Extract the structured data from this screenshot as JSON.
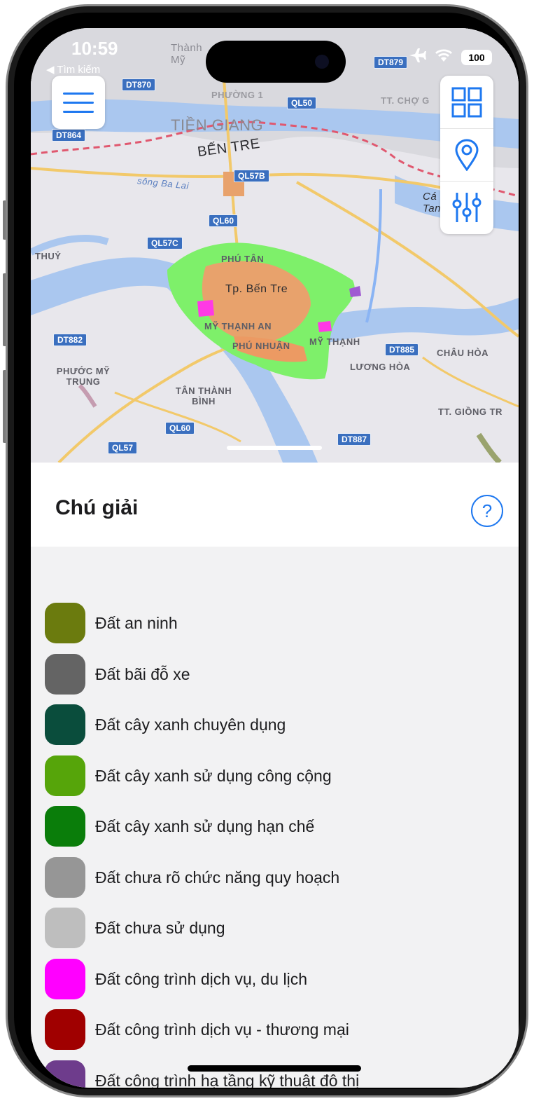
{
  "status_bar": {
    "time": "10:59",
    "back_label": "◀ Tìm kiếm",
    "battery": "100"
  },
  "map": {
    "city_label": "Tp. Bến Tre",
    "province_labels": [
      "TIỀN GIANG",
      "BẾN TRE"
    ],
    "place_labels": [
      "PHÚ TÂN",
      "MỸ THẠNH AN",
      "PHÚ NHUẬN",
      "MỸ THẠNH",
      "LƯƠNG HÒA",
      "CHÂU HÒA",
      "PHƯỚC MỸ TRUNG",
      "TÂN THÀNH BÌNH",
      "TT. GIỒNG TR",
      "THUỶ",
      "PHƯỜNG 1",
      "TT. CHỢ G",
      "sông Ba Lai",
      "Thành Mỹ",
      "Cá Tan"
    ],
    "road_labels": [
      "DT870",
      "DT864",
      "QL50",
      "QL57B",
      "QL60",
      "QL57C",
      "DT882",
      "DT885",
      "QL60",
      "QL57",
      "DT887",
      "DT879"
    ]
  },
  "toolbar": {
    "menu_icon": "hamburger-icon",
    "tools": [
      {
        "name": "grid-icon"
      },
      {
        "name": "location-pin-icon"
      },
      {
        "name": "sliders-icon"
      }
    ]
  },
  "legend": {
    "title": "Chú giải",
    "help_label": "?",
    "items": [
      {
        "label": "Đất an ninh",
        "color": "#6b7b0e"
      },
      {
        "label": "Đất bãi đỗ xe",
        "color": "#646464"
      },
      {
        "label": "Đất cây xanh chuyên dụng",
        "color": "#0a4d3c"
      },
      {
        "label": "Đất cây xanh sử dụng công cộng",
        "color": "#56a50a"
      },
      {
        "label": "Đất cây xanh sử dụng hạn chế",
        "color": "#0a7d0a"
      },
      {
        "label": "Đất chưa rõ chức năng quy hoạch",
        "color": "#969696"
      },
      {
        "label": "Đất chưa sử dụng",
        "color": "#bebebe"
      },
      {
        "label": "Đất công trình dịch vụ, du lịch",
        "color": "#ff00ff"
      },
      {
        "label": "Đất công trình dịch vụ - thương mại",
        "color": "#a00000"
      },
      {
        "label": "Đất công trình hạ tầng kỹ thuật đô thị",
        "color": "#6e3c8c"
      }
    ]
  }
}
